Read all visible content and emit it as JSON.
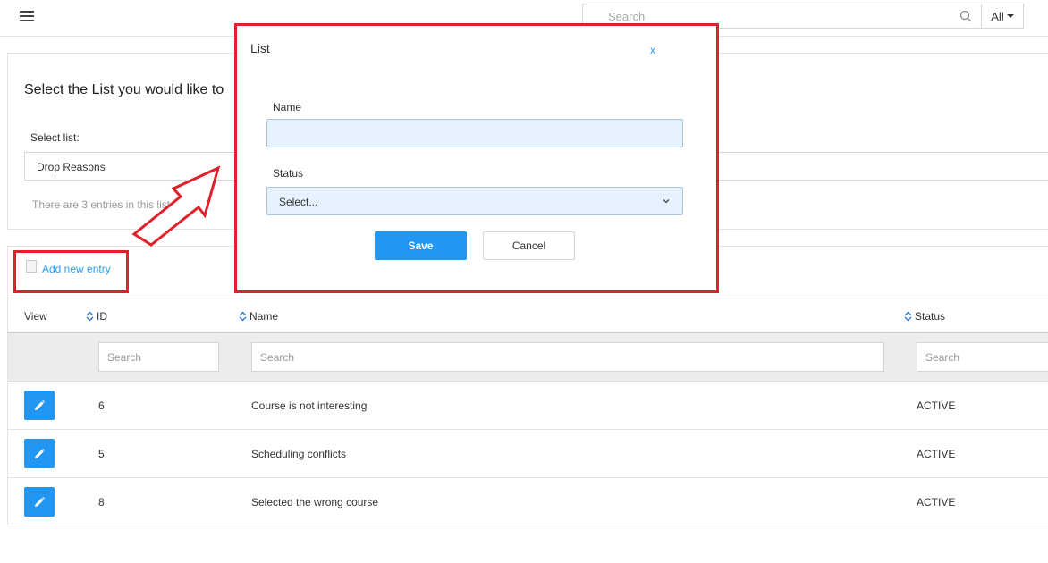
{
  "topbar": {
    "menu_icon": "hamburger-icon",
    "search_placeholder": "Search",
    "search_icon": "magnifier-icon",
    "scope_label": "All"
  },
  "list_select_panel": {
    "heading": "Select the List you would like to",
    "select_label": "Select list:",
    "selected_list": "Drop Reasons",
    "entry_count_text": "There are 3 entries in this list"
  },
  "entries_panel": {
    "add_entry_label": "Add new entry",
    "columns": {
      "view": "View",
      "id": "ID",
      "name": "Name",
      "status": "Status"
    },
    "filter_placeholders": {
      "id": "Search",
      "name": "Search",
      "status": "Search"
    },
    "rows": [
      {
        "id": "6",
        "name": "Course is not interesting",
        "status": "ACTIVE"
      },
      {
        "id": "5",
        "name": "Scheduling conflicts",
        "status": "ACTIVE"
      },
      {
        "id": "8",
        "name": "Selected the wrong course",
        "status": "ACTIVE"
      }
    ]
  },
  "modal": {
    "title": "List",
    "close_label": "x",
    "name_label": "Name",
    "name_value": "",
    "status_label": "Status",
    "status_value": "Select...",
    "save_label": "Save",
    "cancel_label": "Cancel"
  },
  "colors": {
    "accent": "#2196f3",
    "link": "#2a9df4",
    "annotation": "#e0202a"
  }
}
